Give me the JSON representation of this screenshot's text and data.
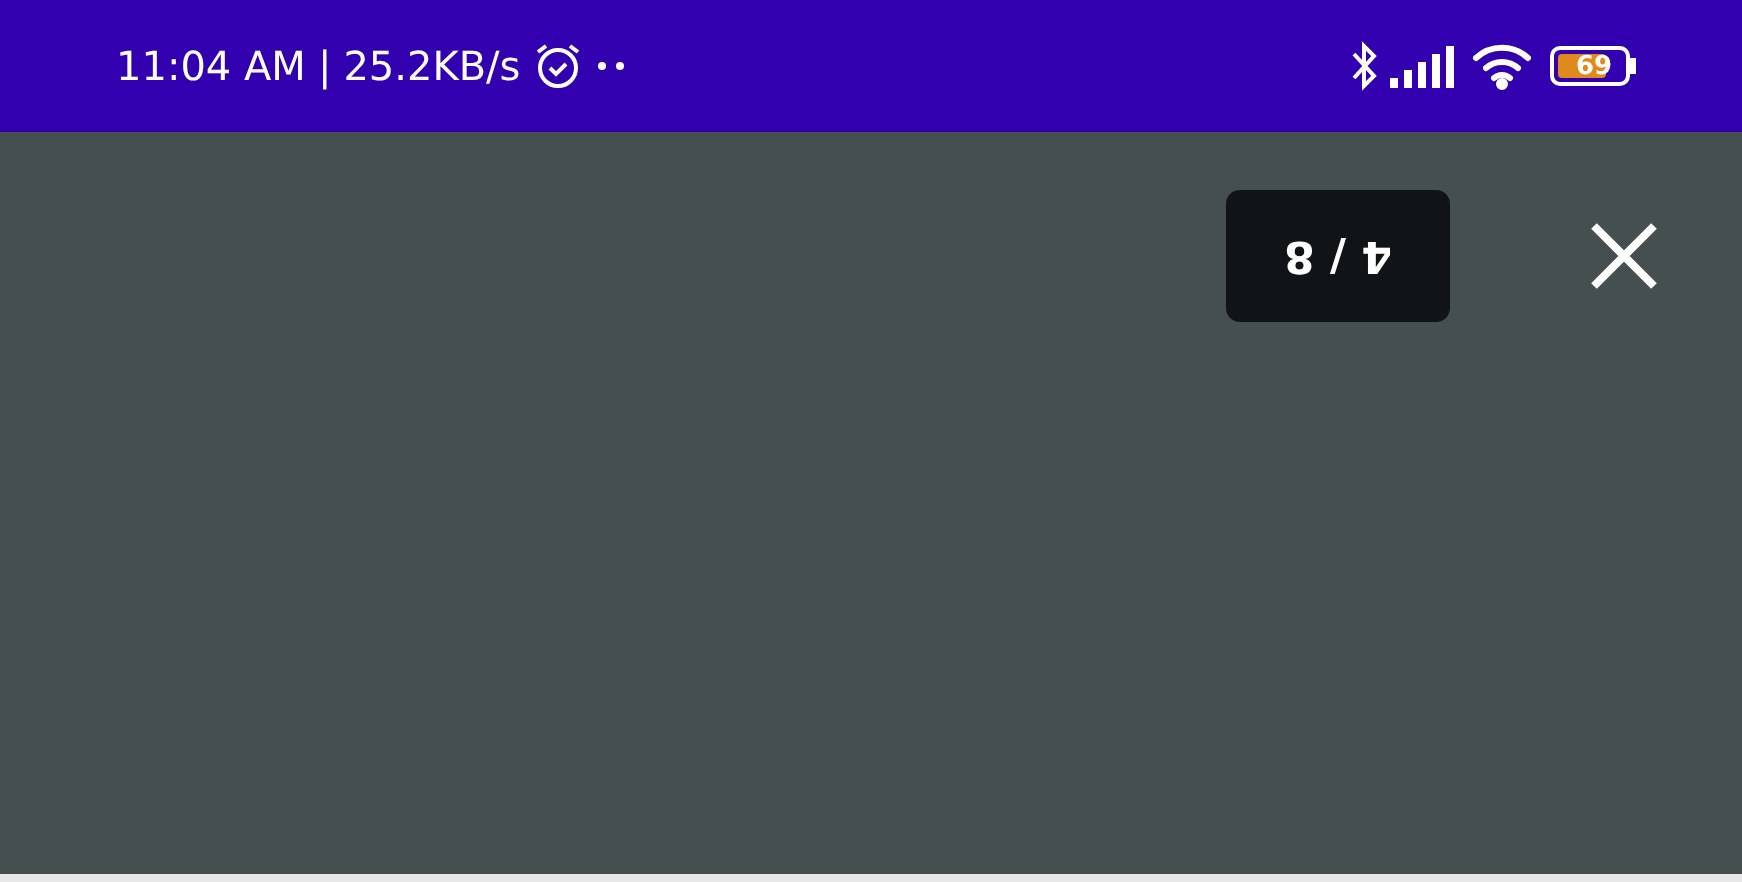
{
  "status_bar": {
    "time": "11:04 AM",
    "separator": "|",
    "speed": "25.2KB/s",
    "battery": "69"
  },
  "viewer": {
    "counter": "4 / 8"
  }
}
